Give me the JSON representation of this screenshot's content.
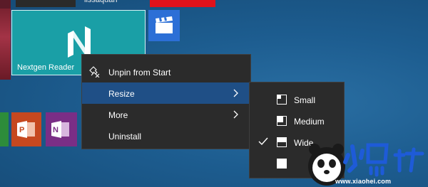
{
  "top_bar": {
    "user_name": "lissaquan"
  },
  "tiles": {
    "nextgen_reader": {
      "label": "Nextgen Reader",
      "color": "#1a9fa6"
    },
    "film": {
      "icon": "film-clapper-icon",
      "color": "#2c6fd6"
    },
    "powerpoint": {
      "icon": "powerpoint-icon",
      "color": "#c6481f"
    },
    "onenote": {
      "icon": "onenote-icon",
      "color": "#7a2e86"
    }
  },
  "context_menu": {
    "items": [
      {
        "label": "Unpin from Start",
        "icon": "unpin-icon"
      },
      {
        "label": "Resize",
        "active": true,
        "has_submenu": true
      },
      {
        "label": "More",
        "has_submenu": true
      },
      {
        "label": "Uninstall"
      }
    ]
  },
  "resize_submenu": {
    "items": [
      {
        "label": "Small",
        "checked": false
      },
      {
        "label": "Medium",
        "checked": false
      },
      {
        "label": "Wide",
        "checked": true
      },
      {
        "label": "",
        "checked": false
      }
    ]
  },
  "watermark": {
    "url": "www.xiaohei.com"
  },
  "colors": {
    "menu_bg": "#2b2b2b",
    "menu_active": "#1f4f86",
    "desktop": "#1c5a8a"
  }
}
